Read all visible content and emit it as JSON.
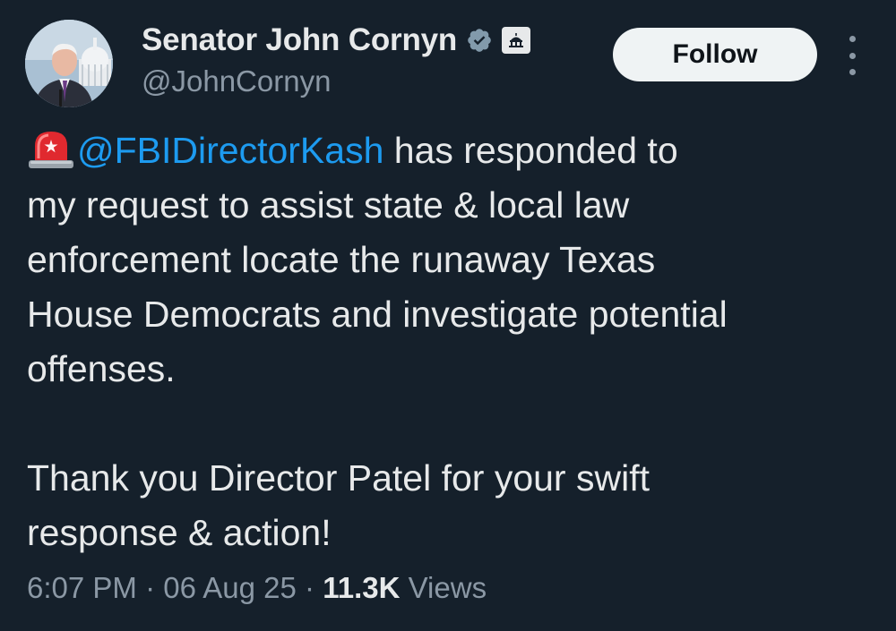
{
  "author": {
    "display_name": "Senator John Cornyn",
    "handle": "@JohnCornyn",
    "avatar": "avatar-photo",
    "badges": [
      "verified-badge-icon",
      "government-badge-icon"
    ]
  },
  "actions": {
    "follow_label": "Follow",
    "more_icon": "more-vertical-icon"
  },
  "tweet": {
    "emoji": "siren-icon",
    "mention": "@FBIDirectorKash",
    "line1_rest": " has responded to",
    "line2": "my request to assist state & local law",
    "line3": "enforcement locate the runaway Texas",
    "line4": "House Democrats and investigate potential",
    "line5": "offenses.",
    "line6": "Thank you Director Patel for your swift",
    "line7": "response & action!"
  },
  "meta": {
    "time": "6:07 PM",
    "separator": " · ",
    "date": "06 Aug 25",
    "views_count": "11.3K",
    "views_label": " Views"
  },
  "colors": {
    "background": "#15202b",
    "text": "#e7e9ea",
    "muted": "#8b98a5",
    "link": "#1d9bf0",
    "verified": "#829aab"
  }
}
